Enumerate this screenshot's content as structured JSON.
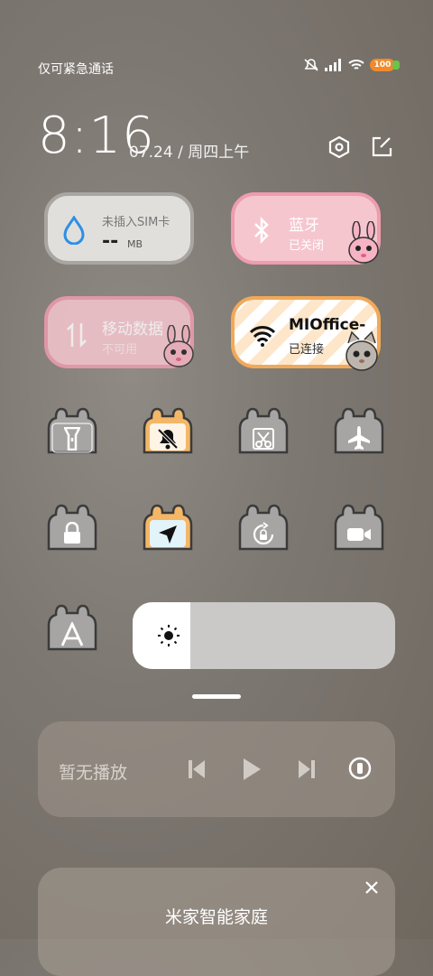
{
  "status": {
    "carrier_text": "仅可紧急通话",
    "battery_level": "100"
  },
  "clock": {
    "time": "8:16",
    "date": "07.24 / 周四上午"
  },
  "tiles": {
    "data": {
      "label": "未插入SIM卡",
      "value": "--",
      "unit": "MB"
    },
    "bluetooth": {
      "label": "蓝牙",
      "status": "已关闭"
    },
    "mobile": {
      "label": "移动数据",
      "status": "不可用"
    },
    "wifi": {
      "label": "MIOffice-",
      "status": "已连接"
    }
  },
  "toggles": [
    {
      "name": "flashlight",
      "icon": "flashlight-icon",
      "active": false
    },
    {
      "name": "silent",
      "icon": "bell-off-icon",
      "active": true
    },
    {
      "name": "screenshot",
      "icon": "scissors-icon",
      "active": false
    },
    {
      "name": "airplane",
      "icon": "airplane-icon",
      "active": false
    },
    {
      "name": "lock",
      "icon": "lock-icon",
      "active": false
    },
    {
      "name": "location",
      "icon": "navigation-arrow-icon",
      "active": true
    },
    {
      "name": "rotation-lock",
      "icon": "rotation-lock-icon",
      "active": false
    },
    {
      "name": "screen-record",
      "icon": "video-camera-icon",
      "active": false
    },
    {
      "name": "auto-brightness",
      "icon": "letter-a-icon",
      "active": false
    }
  ],
  "brightness": {
    "level": 0.0
  },
  "media": {
    "label": "暂无播放"
  },
  "smart_home": {
    "title": "米家智能家庭"
  }
}
